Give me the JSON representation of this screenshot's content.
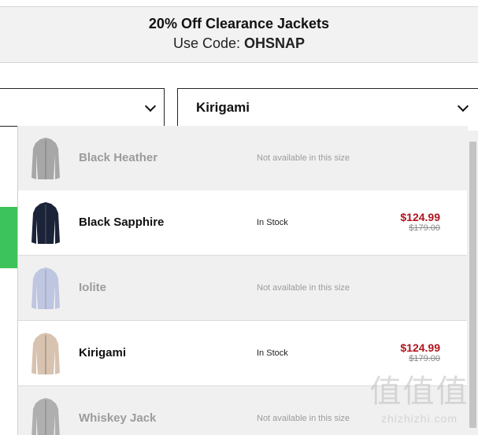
{
  "promo": {
    "title": "20% Off Clearance Jackets",
    "code_prefix": "Use Code: ",
    "code": "OHSNAP"
  },
  "selects": {
    "left_value": "",
    "right_value": "Kirigami"
  },
  "colors": {
    "accent_green": "#3dc35b",
    "sale_red": "#b0141c"
  },
  "options": [
    {
      "name": "Black Heather",
      "status": "Not available in this size",
      "available": false,
      "price": "",
      "original_price": "",
      "jacket_color": "#8f8f8f"
    },
    {
      "name": "Black Sapphire",
      "status": "In Stock",
      "available": true,
      "price": "$124.99",
      "original_price": "$179.00",
      "jacket_color": "#1b2338"
    },
    {
      "name": "Iolite",
      "status": "Not available in this size",
      "available": false,
      "price": "",
      "original_price": "",
      "jacket_color": "#aeb8dc"
    },
    {
      "name": "Kirigami",
      "status": "In Stock",
      "available": true,
      "price": "$124.99",
      "original_price": "$179.00",
      "jacket_color": "#d8c3b0"
    },
    {
      "name": "Whiskey Jack",
      "status": "Not available in this size",
      "available": false,
      "price": "",
      "original_price": "",
      "jacket_color": "#9a9a9a"
    }
  ],
  "watermark": {
    "logo": "值值值",
    "text": "zhizhizhi.com"
  }
}
